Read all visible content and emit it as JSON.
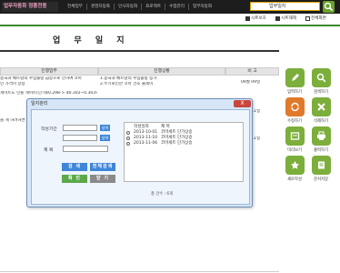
{
  "header": {
    "logo": "업무자동화 정품전용",
    "nav": [
      "전체업무",
      "경영자동화",
      "인사자동화",
      "프로젝트",
      "수업관리",
      "업무자동화"
    ],
    "search_value": "업무일지"
  },
  "toolbar": {
    "sheet_protect": "시트보호",
    "sheet_unprotect": "시트해제",
    "fullscreen": "전체화면"
  },
  "page": {
    "title": "업 무 일 지"
  },
  "table": {
    "headers": [
      "진행업무",
      "진행상황",
      "비 고"
    ],
    "rows": [
      {
        "task": "중국과 베트남의 수입물량 급증으로 인하여 코마",
        "status": "1.중국과 베트남의 수입물량 증가",
        "note": "09월 09일"
      },
      {
        "task": "인 가격이 상승",
        "status": "2.무기로인한 코마 건조 물레이",
        "note": ""
      },
      {
        "task": "게이트도 인플 게이트(단가$0.298-> $0.302~0.303으로",
        "status": "",
        "note": ""
      },
      {
        "task": "",
        "status": "",
        "note": "09월 11일"
      },
      {
        "task": "을 게 하려하면 보",
        "status": "",
        "note": ""
      },
      {
        "task": "",
        "status": "",
        "note": "10월 11일"
      }
    ]
  },
  "sidebar": {
    "buttons": [
      {
        "label": "입력하기",
        "color": "#7cae3c",
        "icon": "pencil-icon"
      },
      {
        "label": "검색하기",
        "color": "#7cae3c",
        "icon": "search-icon"
      },
      {
        "label": "수정하기",
        "color": "#e07a2a",
        "icon": "edit-icon"
      },
      {
        "label": "삭제하기",
        "color": "#7cae3c",
        "icon": "delete-icon"
      },
      {
        "label": "미리보기",
        "color": "#7cae3c",
        "icon": "preview-icon"
      },
      {
        "label": "출력하기",
        "color": "#7cae3c",
        "icon": "print-icon"
      },
      {
        "label": "새로작성",
        "color": "#7cae3c",
        "icon": "new-doc-icon"
      },
      {
        "label": "문서저장",
        "color": "#7cae3c",
        "icon": "save-icon"
      }
    ]
  },
  "dialog": {
    "title": "일지관리",
    "close": "X",
    "fields": {
      "period_label": "작성기간",
      "title_label": "제   목",
      "date_btn": "달력"
    },
    "buttons": {
      "search": "검 색",
      "search_all": "전체검색",
      "confirm": "확 인",
      "close": "닫 기"
    },
    "list": {
      "headers": [
        "작성일자",
        "제 목"
      ],
      "rows": [
        {
          "date": "2013-10-01",
          "title": "코마세트 단가상승"
        },
        {
          "date": "2013-11-10",
          "title": "코마세트 단가상승"
        },
        {
          "date": "2013-11-06",
          "title": "코마세트 단가상승"
        }
      ]
    },
    "count": "총 건수 : 6개"
  }
}
